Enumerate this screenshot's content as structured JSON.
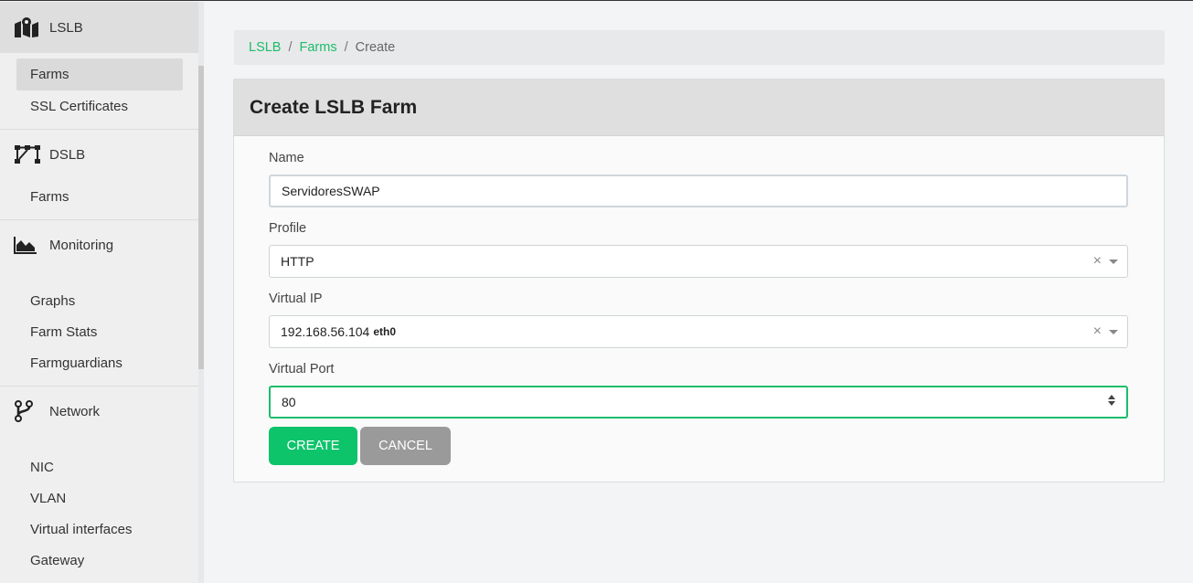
{
  "sidebar": {
    "lslb": {
      "title": "LSLB",
      "items": [
        {
          "label": "Farms"
        },
        {
          "label": "SSL Certificates"
        }
      ]
    },
    "dslb": {
      "title": "DSLB",
      "items": [
        {
          "label": "Farms"
        }
      ]
    },
    "monitoring": {
      "title": "Monitoring",
      "items": [
        {
          "label": "Graphs"
        },
        {
          "label": "Farm Stats"
        },
        {
          "label": "Farmguardians"
        }
      ]
    },
    "network": {
      "title": "Network",
      "items": [
        {
          "label": "NIC"
        },
        {
          "label": "VLAN"
        },
        {
          "label": "Virtual interfaces"
        },
        {
          "label": "Gateway"
        }
      ]
    }
  },
  "breadcrumb": {
    "items": [
      "LSLB",
      "Farms"
    ],
    "separator": "/",
    "current": "Create"
  },
  "card": {
    "title": "Create LSLB Farm"
  },
  "form": {
    "name": {
      "label": "Name",
      "value": "ServidoresSWAP"
    },
    "profile": {
      "label": "Profile",
      "value": "HTTP"
    },
    "virtual_ip": {
      "label": "Virtual IP",
      "value": "192.168.56.104",
      "interface": "eth0"
    },
    "virtual_port": {
      "label": "Virtual Port",
      "value": "80"
    },
    "clear_symbol": "×"
  },
  "buttons": {
    "create": "CREATE",
    "cancel": "CANCEL"
  },
  "colors": {
    "accent": "#0ec46b",
    "link": "#1cbd6b",
    "cancel": "#9a9a9a"
  }
}
